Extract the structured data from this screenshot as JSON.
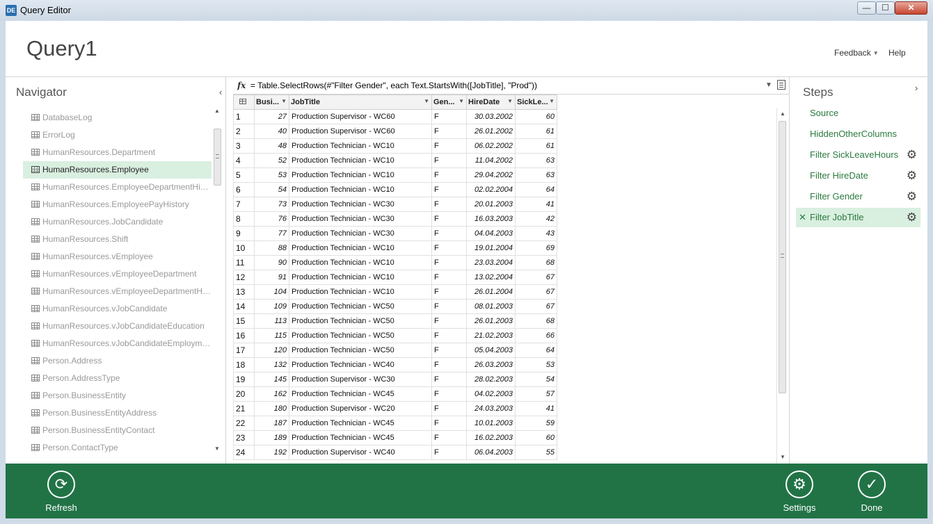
{
  "window": {
    "title": "Query Editor",
    "app_icon": "DE",
    "minimize": "—",
    "maximize": "☐",
    "close": "✕"
  },
  "header": {
    "query_title": "Query1",
    "feedback_label": "Feedback",
    "help_label": "Help"
  },
  "navigator": {
    "title": "Navigator",
    "collapse_glyph": "‹",
    "items": [
      {
        "label": "DatabaseLog",
        "selected": false
      },
      {
        "label": "ErrorLog",
        "selected": false
      },
      {
        "label": "HumanResources.Department",
        "selected": false
      },
      {
        "label": "HumanResources.Employee",
        "selected": true
      },
      {
        "label": "HumanResources.EmployeeDepartmentHist...",
        "selected": false
      },
      {
        "label": "HumanResources.EmployeePayHistory",
        "selected": false
      },
      {
        "label": "HumanResources.JobCandidate",
        "selected": false
      },
      {
        "label": "HumanResources.Shift",
        "selected": false
      },
      {
        "label": "HumanResources.vEmployee",
        "selected": false
      },
      {
        "label": "HumanResources.vEmployeeDepartment",
        "selected": false
      },
      {
        "label": "HumanResources.vEmployeeDepartmentHis...",
        "selected": false
      },
      {
        "label": "HumanResources.vJobCandidate",
        "selected": false
      },
      {
        "label": "HumanResources.vJobCandidateEducation",
        "selected": false
      },
      {
        "label": "HumanResources.vJobCandidateEmployment",
        "selected": false
      },
      {
        "label": "Person.Address",
        "selected": false
      },
      {
        "label": "Person.AddressType",
        "selected": false
      },
      {
        "label": "Person.BusinessEntity",
        "selected": false
      },
      {
        "label": "Person.BusinessEntityAddress",
        "selected": false
      },
      {
        "label": "Person.BusinessEntityContact",
        "selected": false
      },
      {
        "label": "Person.ContactType",
        "selected": false
      }
    ]
  },
  "formula": {
    "fx_label": "fx",
    "text": "= Table.SelectRows(#\"Filter Gender\", each Text.StartsWith([JobTitle], \"Prod\"))"
  },
  "grid": {
    "columns": [
      "Busi...",
      "JobTitle",
      "Gen...",
      "HireDate",
      "SickLe..."
    ],
    "rows": [
      [
        "1",
        "27",
        "Production Supervisor - WC60",
        "F",
        "30.03.2002",
        "60"
      ],
      [
        "2",
        "40",
        "Production Supervisor - WC60",
        "F",
        "26.01.2002",
        "61"
      ],
      [
        "3",
        "48",
        "Production Technician - WC10",
        "F",
        "06.02.2002",
        "61"
      ],
      [
        "4",
        "52",
        "Production Technician - WC10",
        "F",
        "11.04.2002",
        "63"
      ],
      [
        "5",
        "53",
        "Production Technician - WC10",
        "F",
        "29.04.2002",
        "63"
      ],
      [
        "6",
        "54",
        "Production Technician - WC10",
        "F",
        "02.02.2004",
        "64"
      ],
      [
        "7",
        "73",
        "Production Technician - WC30",
        "F",
        "20.01.2003",
        "41"
      ],
      [
        "8",
        "76",
        "Production Technician - WC30",
        "F",
        "16.03.2003",
        "42"
      ],
      [
        "9",
        "77",
        "Production Technician - WC30",
        "F",
        "04.04.2003",
        "43"
      ],
      [
        "10",
        "88",
        "Production Technician - WC10",
        "F",
        "19.01.2004",
        "69"
      ],
      [
        "11",
        "90",
        "Production Technician - WC10",
        "F",
        "23.03.2004",
        "68"
      ],
      [
        "12",
        "91",
        "Production Technician - WC10",
        "F",
        "13.02.2004",
        "67"
      ],
      [
        "13",
        "104",
        "Production Technician - WC10",
        "F",
        "26.01.2004",
        "67"
      ],
      [
        "14",
        "109",
        "Production Technician - WC50",
        "F",
        "08.01.2003",
        "67"
      ],
      [
        "15",
        "113",
        "Production Technician - WC50",
        "F",
        "26.01.2003",
        "68"
      ],
      [
        "16",
        "115",
        "Production Technician - WC50",
        "F",
        "21.02.2003",
        "66"
      ],
      [
        "17",
        "120",
        "Production Technician - WC50",
        "F",
        "05.04.2003",
        "64"
      ],
      [
        "18",
        "132",
        "Production Technician - WC40",
        "F",
        "26.03.2003",
        "53"
      ],
      [
        "19",
        "145",
        "Production Supervisor - WC30",
        "F",
        "28.02.2003",
        "54"
      ],
      [
        "20",
        "162",
        "Production Technician - WC45",
        "F",
        "04.02.2003",
        "57"
      ],
      [
        "21",
        "180",
        "Production Supervisor - WC20",
        "F",
        "24.03.2003",
        "41"
      ],
      [
        "22",
        "187",
        "Production Technician - WC45",
        "F",
        "10.01.2003",
        "59"
      ],
      [
        "23",
        "189",
        "Production Technician - WC45",
        "F",
        "16.02.2003",
        "60"
      ],
      [
        "24",
        "192",
        "Production Supervisor - WC40",
        "F",
        "06.04.2003",
        "55"
      ]
    ]
  },
  "steps": {
    "title": "Steps",
    "collapse_glyph": "›",
    "items": [
      {
        "label": "Source",
        "has_gear": false,
        "selected": false
      },
      {
        "label": "HiddenOtherColumns",
        "has_gear": false,
        "selected": false
      },
      {
        "label": "Filter SickLeaveHours",
        "has_gear": true,
        "selected": false
      },
      {
        "label": "Filter HireDate",
        "has_gear": true,
        "selected": false
      },
      {
        "label": "Filter Gender",
        "has_gear": true,
        "selected": false
      },
      {
        "label": "Filter JobTitle",
        "has_gear": true,
        "selected": true
      }
    ]
  },
  "ribbon": {
    "refresh_label": "Refresh",
    "settings_label": "Settings",
    "done_label": "Done"
  },
  "colors": {
    "ribbon_green": "#217346",
    "selection_green": "#d9efe0",
    "step_text_green": "#2a7a3e"
  },
  "icons": {
    "refresh": "refresh-icon",
    "settings": "gear-icon",
    "done": "checkmark-icon",
    "table": "table-icon"
  }
}
